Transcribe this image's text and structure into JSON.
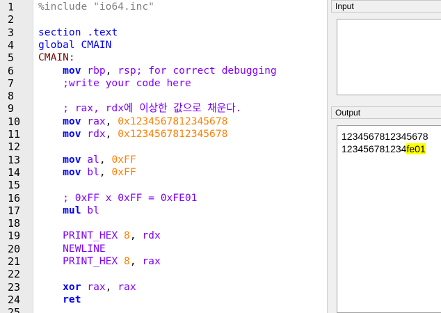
{
  "editor": {
    "line_numbers": [
      "1",
      "2",
      "3",
      "4",
      "5",
      "6",
      "7",
      "8",
      "9",
      "10",
      "11",
      "12",
      "13",
      "14",
      "15",
      "16",
      "17",
      "18",
      "19",
      "20",
      "21",
      "22",
      "23",
      "24",
      "25"
    ],
    "lines": {
      "l1": {
        "a": "%include",
        "b": " \"io64.inc\""
      },
      "l3": {
        "a": "section",
        "b": " .text"
      },
      "l4": {
        "a": "global",
        "b": " CMAIN"
      },
      "l5": {
        "a": "CMAIN:"
      },
      "l6": {
        "a": "    mov",
        "b": " rbp",
        "c": ",",
        "d": " rsp",
        "e": "; for correct debugging"
      },
      "l7": {
        "a": "    ;write your code here"
      },
      "l9": {
        "a": "    ; rax, rdx에 이상한 값으로 채운다."
      },
      "l10": {
        "a": "    mov",
        "b": " rax",
        "c": ",",
        "d": " 0x1234567812345678"
      },
      "l11": {
        "a": "    mov",
        "b": " rdx",
        "c": ",",
        "d": " 0x1234567812345678"
      },
      "l13": {
        "a": "    mov",
        "b": " al",
        "c": ",",
        "d": " 0xFF"
      },
      "l14": {
        "a": "    mov",
        "b": " bl",
        "c": ",",
        "d": " 0xFF"
      },
      "l16": {
        "a": "    ; 0xFF x 0xFF = 0xFE01"
      },
      "l17": {
        "a": "    mul",
        "b": " bl"
      },
      "l19": {
        "a": "    PRINT_HEX",
        "b": " 8",
        "c": ",",
        "d": " rdx"
      },
      "l20": {
        "a": "    NEWLINE"
      },
      "l21": {
        "a": "    PRINT_HEX",
        "b": " 8",
        "c": ",",
        "d": " rax"
      },
      "l23": {
        "a": "    xor",
        "b": " rax",
        "c": ",",
        "d": " rax"
      },
      "l24": {
        "a": "    ret"
      }
    }
  },
  "input_panel": {
    "title": "Input"
  },
  "output_panel": {
    "title": "Output",
    "line1": "1234567812345678",
    "line2_plain": "123456781234",
    "line2_highlight": "fe01"
  },
  "colors": {
    "keyword": "#0000ff",
    "register": "#8000ff",
    "number": "#ff8000",
    "label": "#800000",
    "highlight": "#ffff00"
  }
}
